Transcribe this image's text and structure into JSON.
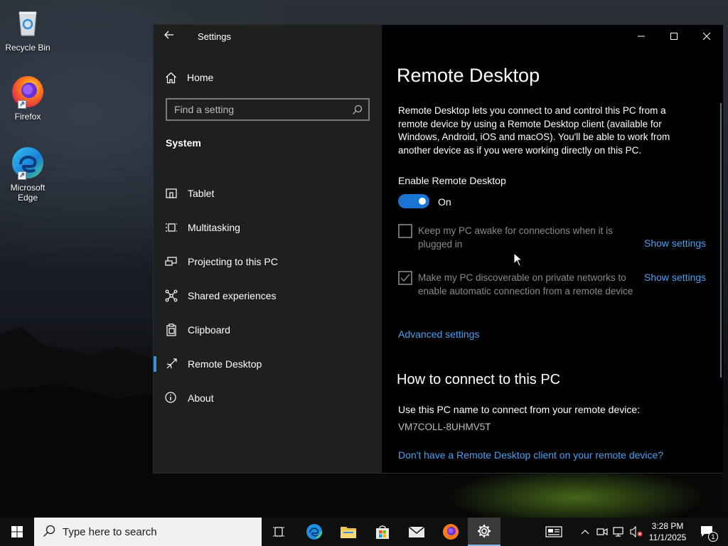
{
  "desktop": {
    "icons": [
      {
        "label": "Recycle Bin"
      },
      {
        "label": "Firefox"
      },
      {
        "label": "Microsoft Edge"
      }
    ]
  },
  "window": {
    "app_title": "Settings",
    "nav": {
      "home_label": "Home",
      "search_placeholder": "Find a setting",
      "section_title": "System",
      "items": [
        {
          "label": "Tablet",
          "icon": "tablet-icon"
        },
        {
          "label": "Multitasking",
          "icon": "multitasking-icon"
        },
        {
          "label": "Projecting to this PC",
          "icon": "projecting-icon"
        },
        {
          "label": "Shared experiences",
          "icon": "shared-experiences-icon"
        },
        {
          "label": "Clipboard",
          "icon": "clipboard-icon"
        },
        {
          "label": "Remote Desktop",
          "icon": "remote-desktop-icon",
          "active": true
        },
        {
          "label": "About",
          "icon": "info-icon"
        }
      ]
    },
    "content": {
      "title": "Remote Desktop",
      "description": "Remote Desktop lets you connect to and control this PC from a remote device by using a Remote Desktop client (available for Windows, Android, iOS and macOS). You'll be able to work from another device as if you were working directly on this PC.",
      "enable_label": "Enable Remote Desktop",
      "toggle_state": "On",
      "toggle_on": true,
      "options": [
        {
          "text": "Keep my PC awake for connections when it is plugged in",
          "checked": false,
          "link": "Show settings"
        },
        {
          "text": "Make my PC discoverable on private networks to enable automatic connection from a remote device",
          "checked": true,
          "link": "Show settings"
        }
      ],
      "advanced_link": "Advanced settings",
      "how_to_title": "How to connect to this PC",
      "use_name_text": "Use this PC name to connect from your remote device:",
      "pc_name": "VM7COLL-8UHMV5T",
      "client_link": "Don't have a Remote Desktop client on your remote device?"
    }
  },
  "taskbar": {
    "search_placeholder": "Type here to search",
    "time": "3:28 PM",
    "date": "11/1/2025",
    "notification_count": "1"
  },
  "colors": {
    "accent": "#1a74d4",
    "link": "#4aa0f0",
    "nav_bg": "#1f1f1f",
    "content_bg": "#000000"
  }
}
